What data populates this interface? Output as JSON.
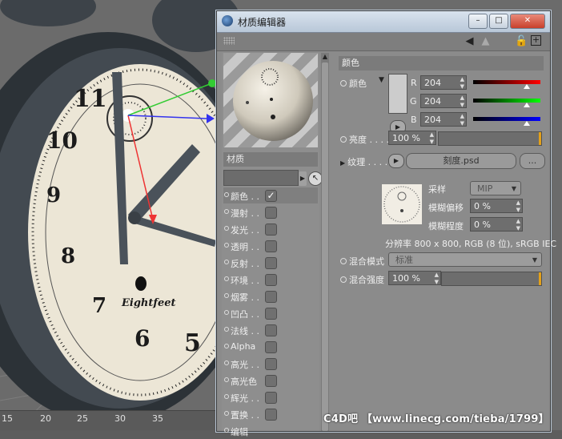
{
  "window": {
    "title": "材质编辑器",
    "btn_min": "–",
    "btn_max": "□",
    "btn_close": "✕"
  },
  "viewport": {
    "ruler_ticks": [
      "15",
      "20",
      "25",
      "30",
      "35"
    ],
    "clock_numbers": [
      "11",
      "10",
      "9",
      "8",
      "7",
      "6",
      "5"
    ],
    "clock_brand": "Eightfeet"
  },
  "left_panel": {
    "section_title": "材质",
    "channels": [
      {
        "label": "颜色 . .",
        "checked": true
      },
      {
        "label": "漫射 . .",
        "checked": false
      },
      {
        "label": "发光 . .",
        "checked": false
      },
      {
        "label": "透明 . .",
        "checked": false
      },
      {
        "label": "反射 . .",
        "checked": false
      },
      {
        "label": "环境 . .",
        "checked": false
      },
      {
        "label": "烟雾 . .",
        "checked": false
      },
      {
        "label": "凹凸 . .",
        "checked": false
      },
      {
        "label": "法线 . .",
        "checked": false
      },
      {
        "label": "Alpha",
        "checked": false
      },
      {
        "label": "高光 . .",
        "checked": false
      },
      {
        "label": "高光色",
        "checked": false
      },
      {
        "label": "辉光 . .",
        "checked": false
      },
      {
        "label": "置换 . .",
        "checked": false
      },
      {
        "label": "编辑",
        "checked": false
      }
    ]
  },
  "right_panel": {
    "header": "颜色",
    "color_label": "颜色",
    "r_label": "R",
    "r_value": "204",
    "g_label": "G",
    "g_value": "204",
    "b_label": "B",
    "b_value": "204",
    "r_level": 0.8,
    "g_level": 0.8,
    "b_level": 0.8,
    "brightness_label": "亮度 . . . .",
    "brightness_value": "100 %",
    "texture_label": "纹理 . . . .",
    "texture_file": "刻度.psd",
    "texture_more": "...",
    "sampling_label": "采样",
    "sampling_value": "MIP",
    "blur_offset_label": "模糊偏移",
    "blur_offset_value": "0 %",
    "blur_amount_label": "模糊程度",
    "blur_amount_value": "0 %",
    "resolution_text": "分辨率 800 x 800, RGB (8 位), sRGB IEC",
    "mix_mode_label": "混合模式",
    "mix_mode_value": "标准",
    "mix_strength_label": "混合强度",
    "mix_strength_value": "100 %"
  },
  "watermark": "C4D吧 【www.linecg.com/tieba/1799】",
  "colors": {
    "titlebar": "#c8d5e3",
    "panel": "#8b8b8b",
    "accent_orange": "#e3a11a"
  }
}
